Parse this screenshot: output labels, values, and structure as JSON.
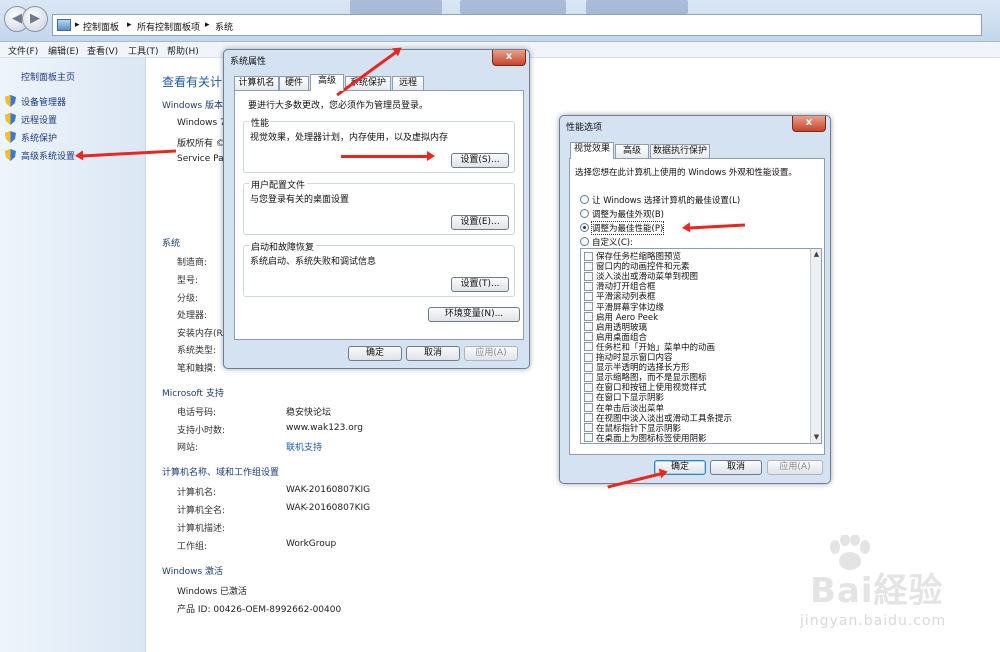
{
  "window": {
    "address_crumbs": [
      "控制面板",
      "所有控制面板项",
      "系统"
    ],
    "menu": [
      "文件(F)",
      "编辑(E)",
      "查看(V)",
      "工具(T)",
      "帮助(H)"
    ]
  },
  "sidebar": {
    "home": "控制面板主页",
    "items": [
      {
        "label": "设备管理器"
      },
      {
        "label": "远程设置"
      },
      {
        "label": "系统保护"
      },
      {
        "label": "高级系统设置"
      }
    ]
  },
  "main": {
    "title": "查看有关计",
    "edition_head": "Windows 版本",
    "edition_lines": [
      "Windows 7",
      "版权所有 ©",
      "Service Pac"
    ],
    "system_head": "系统",
    "system_labels": [
      "制造商:",
      "型号:",
      "分级:",
      "处理器:",
      "安装内存(RA",
      "系统类型:",
      "笔和触摸:"
    ],
    "support_head": "Microsoft 支持",
    "support": [
      {
        "label": "电话号码:",
        "value": "稳安快论坛"
      },
      {
        "label": "支持小时数:",
        "value": "www.wak123.org"
      },
      {
        "label": "网站:",
        "value": "联机支持"
      }
    ],
    "computer_head": "计算机名称、域和工作组设置",
    "computer": [
      {
        "label": "计算机名:",
        "value": "WAK-20160807KIG"
      },
      {
        "label": "计算机全名:",
        "value": "WAK-20160807KIG"
      },
      {
        "label": "计算机描述:",
        "value": ""
      },
      {
        "label": "工作组:",
        "value": "WorkGroup"
      }
    ],
    "activation_head": "Windows 激活",
    "activation_status": "Windows 已激活",
    "product_id": "产品 ID: 00426-OEM-8992662-00400"
  },
  "sysprops": {
    "title": "系统属性",
    "close": "x",
    "tabs": [
      "计算机名",
      "硬件",
      "高级",
      "系统保护",
      "远程"
    ],
    "admin_note": "要进行大多数更改，您必须作为管理员登录。",
    "perf_title": "性能",
    "perf_desc": "视觉效果，处理器计划，内存使用，以及虚拟内存",
    "perf_btn": "设置(S)...",
    "profile_title": "用户配置文件",
    "profile_desc": "与您登录有关的桌面设置",
    "profile_btn": "设置(E)...",
    "startup_title": "启动和故障恢复",
    "startup_desc": "系统启动、系统失败和调试信息",
    "startup_btn": "设置(T)...",
    "env_btn": "环境变量(N)...",
    "ok": "确定",
    "cancel": "取消",
    "apply": "应用(A)"
  },
  "perfopts": {
    "title": "性能选项",
    "close": "x",
    "tabs": [
      "视觉效果",
      "高级",
      "数据执行保护"
    ],
    "intro": "选择您想在此计算机上使用的 Windows 外观和性能设置。",
    "radios": [
      {
        "label": "让 Windows 选择计算机的最佳设置(L)",
        "selected": false
      },
      {
        "label": "调整为最佳外观(B)",
        "selected": false
      },
      {
        "label": "调整为最佳性能(P)",
        "selected": true
      },
      {
        "label": "自定义(C):",
        "selected": false
      }
    ],
    "checks": [
      "保存任务栏缩略图预览",
      "窗口内的动画控件和元素",
      "淡入淡出或滑动菜单到视图",
      "滑动打开组合框",
      "平滑滚动列表框",
      "平滑屏幕字体边缘",
      "启用 Aero Peek",
      "启用透明玻璃",
      "启用桌面组合",
      "任务栏和「开始」菜单中的动画",
      "拖动时显示窗口内容",
      "显示半透明的选择长方形",
      "显示缩略图，而不是显示图标",
      "在窗口和按钮上使用视觉样式",
      "在窗口下显示阴影",
      "在单击后淡出菜单",
      "在视图中淡入淡出或滑动工具条提示",
      "在鼠标指针下显示阴影",
      "在桌面上为图标标签使用阴影"
    ],
    "ok": "确定",
    "cancel": "取消",
    "apply": "应用(A)"
  },
  "watermark": {
    "text": "Bai経验",
    "url": "jingyan.baidu.com"
  }
}
